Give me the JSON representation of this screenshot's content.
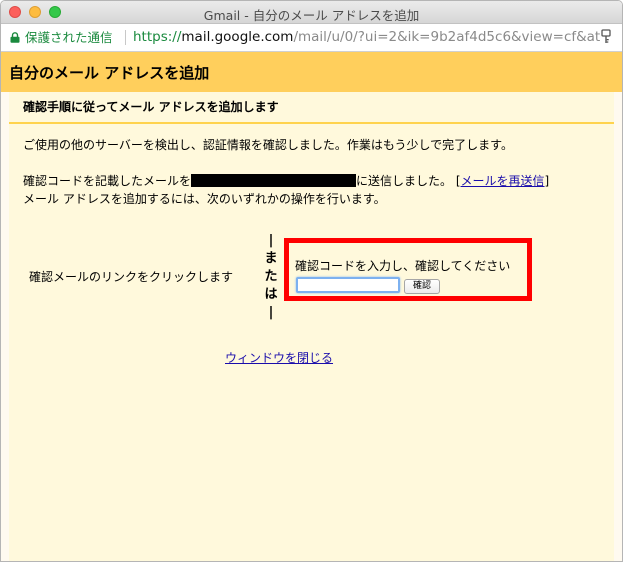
{
  "window": {
    "title": "Gmail - 自分のメール アドレスを追加"
  },
  "address_bar": {
    "security_label": "保護された通信",
    "url_scheme": "https://",
    "url_host": "mail.google.com",
    "url_path": "/mail/u/0/?ui=2&ik=9b2af4d5c6&view=cf&at..."
  },
  "page": {
    "header_title": "自分のメール アドレスを追加",
    "subtitle": "確認手順に従ってメール アドレスを追加します",
    "intro_text": "ご使用の他のサーバーを検出し、認証情報を確認しました。作業はもう少しで完了します。",
    "sent_prefix": "確認コードを記載したメールを",
    "sent_suffix": "に送信しました。 [",
    "resend_link": "メールを再送信",
    "bracket_close": "]",
    "instruction": "メール アドレスを追加するには、次のいずれかの操作を行います。",
    "option_link_text": "確認メールのリンクをクリックします",
    "or_bar_top": "|",
    "or_chars": [
      "ま",
      "た",
      "は"
    ],
    "or_bar_bottom": "|",
    "code_prompt": "確認コードを入力し、確認してください",
    "code_value": "",
    "confirm_button": "確認",
    "close_window_link": "ウィンドウを閉じる"
  },
  "colors": {
    "header_bg": "#ffcf5c",
    "content_bg": "#fff9dc",
    "highlight_border": "#ff0000",
    "link": "#1a0dab",
    "secure_green": "#1a8a3e"
  }
}
